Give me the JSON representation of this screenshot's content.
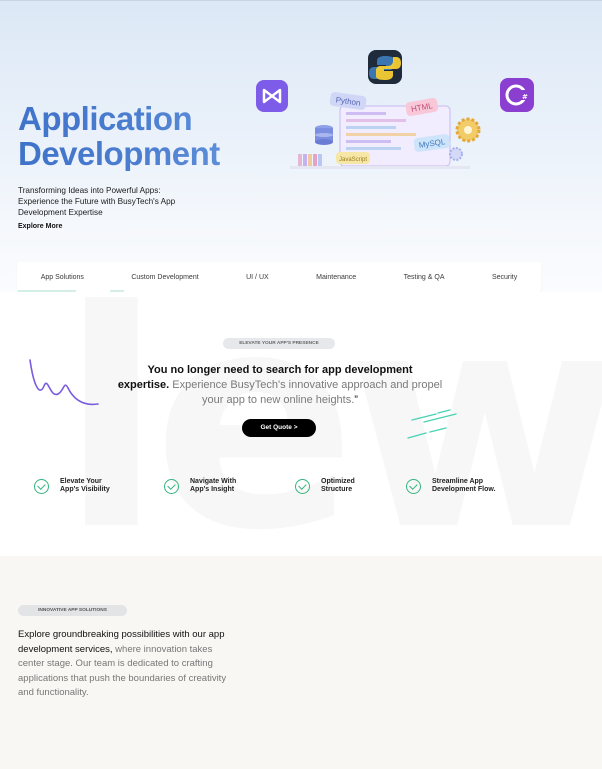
{
  "hero": {
    "title_line1": "Application",
    "title_line2": "Development",
    "subtitle_line1": "Transforming Ideas into Powerful Apps:",
    "subtitle_line2": "Experience the Future with BusyTech's App",
    "subtitle_line3": "Development Expertise",
    "explore_label": "Explore More",
    "illustration": {
      "tags": [
        "Python",
        "HTML",
        "MySQL",
        "JavaScript"
      ],
      "icons": [
        "visual-studio-icon",
        "python-icon",
        "csharp-icon",
        "database-icon",
        "gear-icon",
        "books-icon"
      ]
    }
  },
  "tabs": [
    {
      "label": "App Solutions"
    },
    {
      "label": "Custom Development"
    },
    {
      "label": "UI / UX"
    },
    {
      "label": "Maintenance"
    },
    {
      "label": "Testing & QA"
    },
    {
      "label": "Security"
    }
  ],
  "mid": {
    "watermark": "lew",
    "pill": "ELEVATE YOUR APP'S PRESENCE",
    "quote_bold1": "You no longer need to search for app development",
    "quote_bold2": "expertise.",
    "quote_dim": "Experience BusyTech's innovative approach and propel your app to new online heights.",
    "quote_end": "”",
    "cta_label": "Get Quote",
    "cta_arrow": ">",
    "features": [
      {
        "line1": "Elevate Your",
        "line2": "App's Visibility"
      },
      {
        "line1": "Navigate With",
        "line2": "App's Insight"
      },
      {
        "line1": "Optimized",
        "line2": "Structure"
      },
      {
        "line1": "Streamline App",
        "line2": "Development Flow."
      }
    ]
  },
  "lower": {
    "pill": "INNOVATIVE APP SOLUTIONS",
    "text_dark": "Explore groundbreaking possibilities with our app development services,",
    "text_dim": "where innovation takes center stage. Our team is dedicated to crafting applications that push the boundaries of creativity and functionality."
  },
  "colors": {
    "title_blue": "#4a78c8",
    "check_green": "#36b37e",
    "cta_black": "#000000",
    "lower_bg": "#f8f7f4"
  }
}
